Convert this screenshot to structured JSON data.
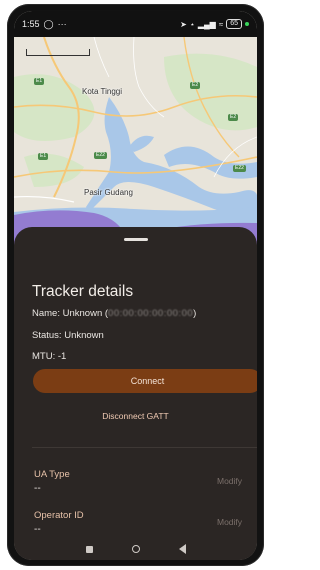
{
  "status_bar": {
    "time": "1:55",
    "left_icons": [
      "whatsapp-icon",
      "more-icon"
    ],
    "right_icons": [
      "navigation-icon",
      "bluetooth-icon",
      "signal-icon",
      "wifi-icon"
    ],
    "battery": "65"
  },
  "map": {
    "labels": {
      "kota_tinggi": "Kota Tinggi",
      "pasir_gudang": "Pasir Gudang"
    },
    "road_shields": [
      "E1",
      "E2",
      "E2",
      "E22",
      "E22",
      "E1"
    ],
    "colors": {
      "land": "#e8e4da",
      "water": "#a9c7e8",
      "green": "#cfe3bf",
      "purple": "#8f6fcc",
      "road": "#f6c877"
    }
  },
  "sheet": {
    "title": "Tracker details",
    "name_label": "Name: Unknown (",
    "name_mac_redacted": "00:00:00:00:00:00",
    "name_close": ")",
    "status": "Status: Unknown",
    "mtu": "MTU: -1",
    "connect_label": "Connect",
    "disconnect_label": "Disconnect GATT",
    "fields": [
      {
        "label": "UA Type",
        "value": "--",
        "action": "Modify"
      },
      {
        "label": "Operator ID",
        "value": "--",
        "action": "Modify"
      }
    ],
    "colors": {
      "background": "#2b2624",
      "button": "#7b3d14",
      "field_label": "#e7c2a9"
    }
  },
  "navbar": {
    "buttons": [
      "recents-icon",
      "home-icon",
      "back-icon"
    ]
  }
}
